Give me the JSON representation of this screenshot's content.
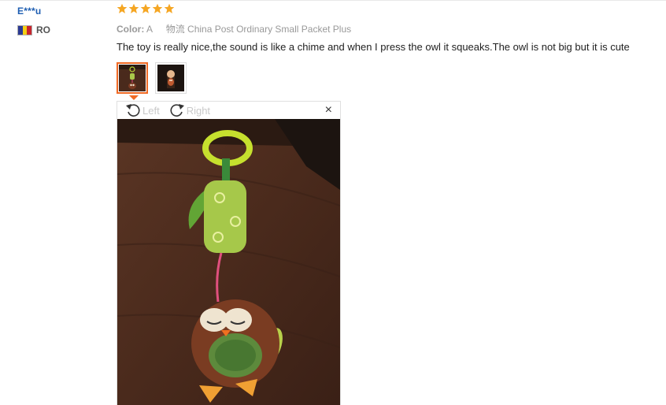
{
  "reviewer": {
    "name": "E***u",
    "country_code": "RO",
    "flag_colors": [
      "#2b3a93",
      "#f4d013",
      "#c8262e"
    ]
  },
  "rating": {
    "stars": 5,
    "max": 5,
    "color": "#f5a623"
  },
  "meta": {
    "color_label": "Color:",
    "color_value": "A",
    "shipping_label": "物流",
    "shipping_value": "China Post Ordinary Small Packet Plus"
  },
  "review_text": "The toy is really nice,the sound is like a chime and when I press the owl it squeaks.The owl is not big but it is cute",
  "thumbnails": [
    {
      "name": "photo-1",
      "active": true
    },
    {
      "name": "photo-2",
      "active": false
    }
  ],
  "viewer": {
    "rotate_left_label": "Left",
    "rotate_right_label": "Right",
    "close_label": "×"
  },
  "colors": {
    "accent": "#f06a25",
    "link": "#1e5eb2"
  }
}
